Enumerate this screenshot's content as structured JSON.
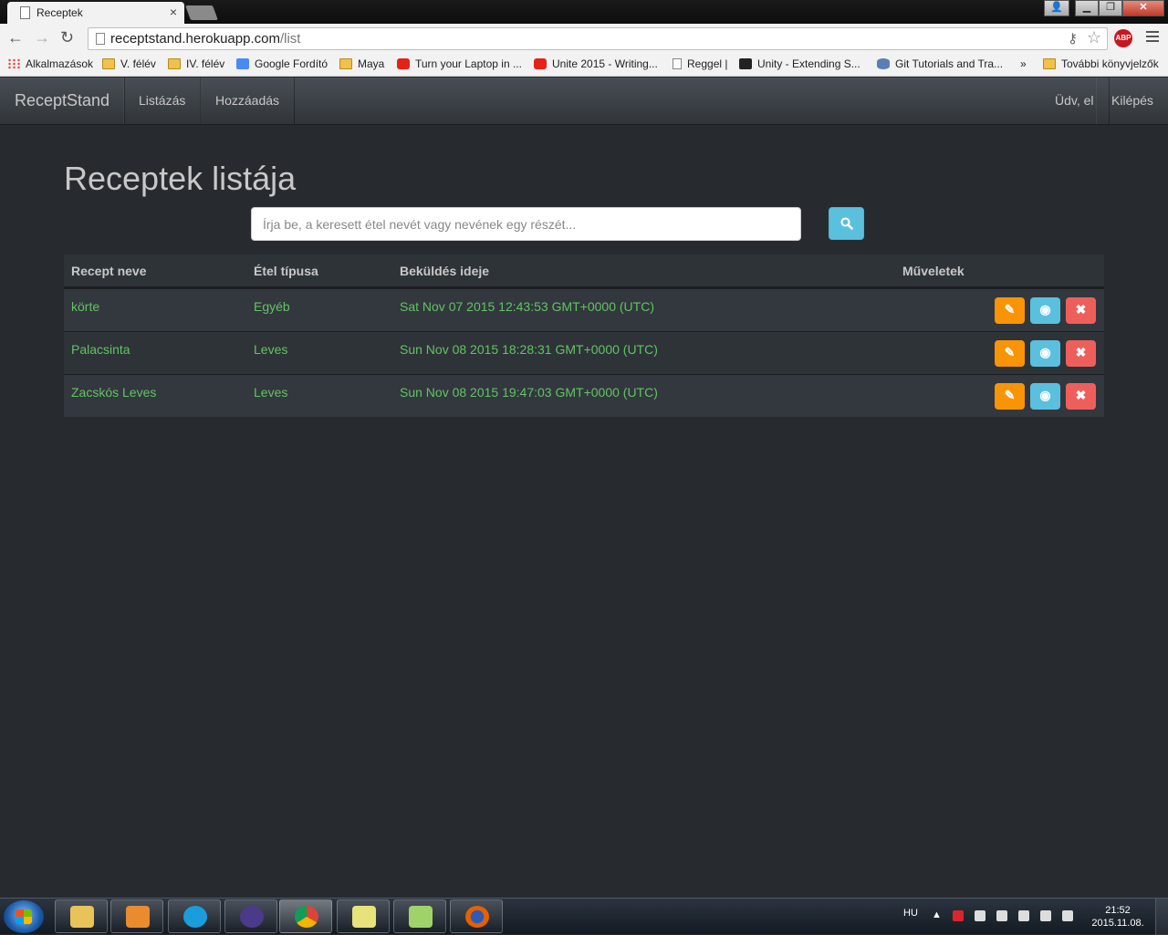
{
  "browser": {
    "tab_title": "Receptek",
    "tab_close": "×",
    "url_host": "receptstand.herokuapp.com",
    "url_path": "/list",
    "abp_label": "ABP",
    "bookmarks": [
      {
        "label": "Alkalmazások",
        "icon": "apps-icon"
      },
      {
        "label": "V. félév",
        "icon": "folder-icon"
      },
      {
        "label": "IV. félév",
        "icon": "folder-icon"
      },
      {
        "label": "Google Fordító",
        "icon": "translate-icon"
      },
      {
        "label": "Maya",
        "icon": "folder-icon"
      },
      {
        "label": "Turn your Laptop in ...",
        "icon": "youtube-icon"
      },
      {
        "label": "Unite 2015 - Writing...",
        "icon": "youtube-icon"
      },
      {
        "label": "Reggel |",
        "icon": "page-icon"
      },
      {
        "label": "Unity - Extending S...",
        "icon": "unity-icon"
      },
      {
        "label": "Git Tutorials and Tra...",
        "icon": "database-icon"
      },
      {
        "label": "»",
        "icon": ""
      },
      {
        "label": "További könyvjelzők",
        "icon": "folder-icon"
      }
    ]
  },
  "nav": {
    "brand": "ReceptStand",
    "list_link": "Listázás",
    "add_link": "Hozzáadás",
    "greeting": "Üdv, el",
    "logout": "Kilépés"
  },
  "main": {
    "title": "Receptek listája",
    "search_placeholder": "Írja be, a keresett étel nevét vagy nevének egy részét...",
    "columns": [
      "Recept neve",
      "Étel típusa",
      "Beküldés ideje",
      "Műveletek"
    ],
    "rows": [
      {
        "name": "körte",
        "type": "Egyéb",
        "submitted": "Sat Nov 07 2015 12:43:53 GMT+0000 (UTC)"
      },
      {
        "name": "Palacsinta",
        "type": "Leves",
        "submitted": "Sun Nov 08 2015 18:28:31 GMT+0000 (UTC)"
      },
      {
        "name": "Zacskós Leves",
        "type": "Leves",
        "submitted": "Sun Nov 08 2015 19:47:03 GMT+0000 (UTC)"
      }
    ],
    "action_glyphs": {
      "edit": "✎",
      "view": "◉",
      "delete": "✖"
    }
  },
  "colors": {
    "background": "#272b30",
    "text_green": "#62c462",
    "edit": "#f89406",
    "view": "#5bc0de",
    "delete": "#ee5f5b"
  },
  "taskbar": {
    "language": "HU",
    "time": "21:52",
    "date": "2015.11.08.",
    "apps": [
      "explorer-icon",
      "media-player-icon",
      "telenor-icon",
      "eclipse-icon",
      "chrome-icon",
      "sticky-notes-icon",
      "notepad-plus-plus-icon",
      "firefox-icon"
    ]
  }
}
